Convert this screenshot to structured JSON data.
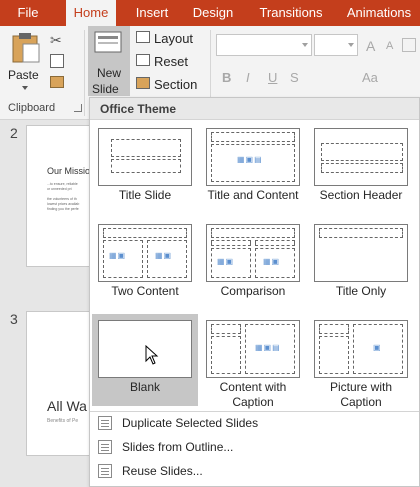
{
  "tabs": [
    "File",
    "Home",
    "Insert",
    "Design",
    "Transitions",
    "Animations"
  ],
  "clipboard": {
    "paste": "Paste",
    "group_label": "Clipboard"
  },
  "slides_group": {
    "new_slide_line1": "New",
    "new_slide_line2": "Slide",
    "layout": "Layout",
    "reset": "Reset",
    "section": "Section"
  },
  "font_group": {
    "bold": "B",
    "italic": "I",
    "underline": "U",
    "strike": "S",
    "aa": "Aa",
    "grow": "A",
    "shrink": "A"
  },
  "slide_panel": {
    "slides": [
      {
        "number": "2",
        "title": "Our Missio",
        "body": "...to ensure, reliable\nor unneeded pri\n\nthe volunteers of th\nlowest prices availab\nfinding you the perfe"
      },
      {
        "number": "3",
        "title": "All Wa",
        "subtitle": "Benefits of Pe"
      }
    ]
  },
  "gallery": {
    "header": "Office Theme",
    "layouts": [
      {
        "name": "Title Slide"
      },
      {
        "name": "Title and Content"
      },
      {
        "name": "Section Header"
      },
      {
        "name": "Two Content"
      },
      {
        "name": "Comparison"
      },
      {
        "name": "Title Only"
      },
      {
        "name": "Blank",
        "selected": true
      },
      {
        "name": "Content with Caption"
      },
      {
        "name": "Picture with Caption"
      }
    ],
    "menu": [
      {
        "label": "Duplicate Selected Slides"
      },
      {
        "label": "Slides from Outline..."
      },
      {
        "label": "Reuse Slides..."
      }
    ]
  },
  "colors": {
    "accent": "#c43e1c",
    "selected_layout": "#c6c6c6"
  }
}
